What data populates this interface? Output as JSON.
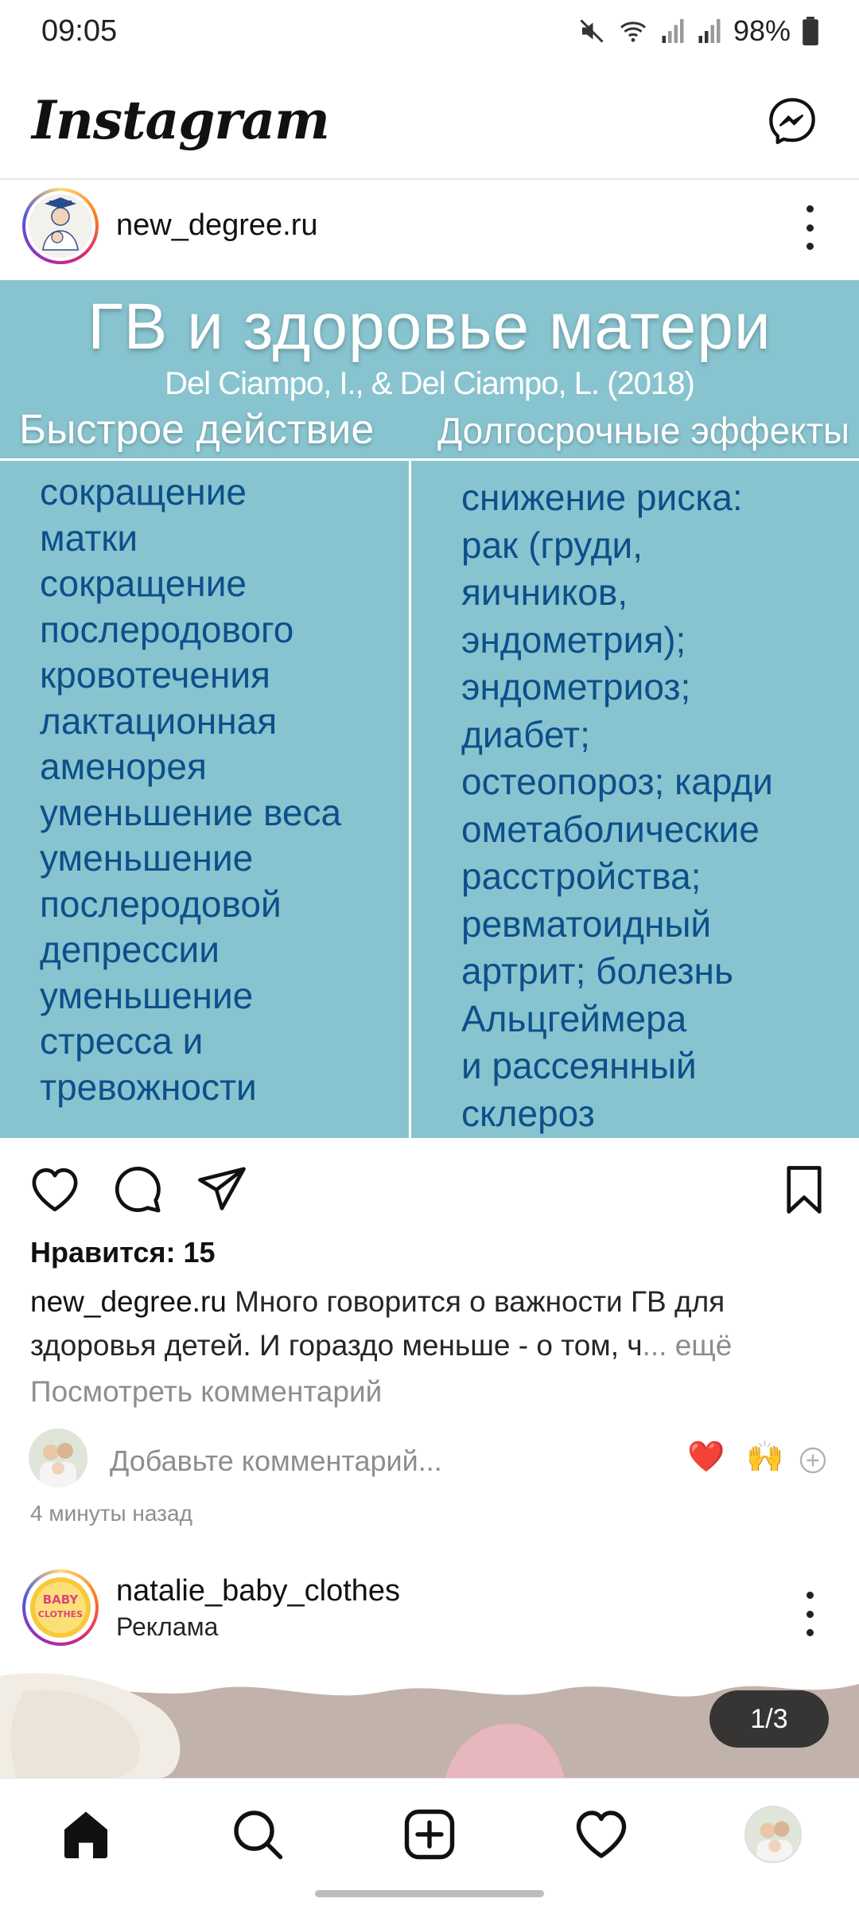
{
  "status": {
    "time": "09:05",
    "battery": "98%",
    "icons": [
      "mute-icon",
      "wifi-icon",
      "signal-icon",
      "signal-icon",
      "battery-icon"
    ]
  },
  "header": {
    "logo": "Instagram",
    "messenger_icon": "messenger-icon"
  },
  "post": {
    "username": "new_degree.ru",
    "image": {
      "title": "ГВ и здоровье матери",
      "subtitle": "Del Ciampo, I., & Del Ciampo, L. (2018)",
      "left_heading": "Быстрое действие",
      "right_heading": "Долгосрочные эффекты",
      "left_text": "сокращение\nматки\nсокращение\nпослеродового\nкровотечения\nлактационная\nаменорея\nуменьшение веса\nуменьшение\nпослеродовой\nдепрессии\nуменьшение\nстресса и\nтревожности",
      "right_text": "снижение риска:\nрак (груди,\nяичников,\nэндометрия);\nэндометриоз;\nдиабет;\nостеопороз; карди\nометаболические\nрасстройства;\nревматоидный\nартрит; болезнь\nАльцгеймера\nи рассеянный\nсклероз"
    },
    "likes": "Нравится: 15",
    "caption_user": "new_degree.ru",
    "caption_text": "Много говорится о важности ГВ для здоровья детей. И гораздо меньше - о том, ч",
    "caption_more": "... ещё",
    "view_comments": "Посмотреть комментарий",
    "comment_placeholder": "Добавьте комментарий...",
    "quick_emojis": [
      "❤️",
      "🙌"
    ],
    "time_ago": "4 минуты назад"
  },
  "post2": {
    "username": "natalie_baby_clothes",
    "sponsored": "Реклама",
    "counter": "1/3"
  },
  "nav": {
    "items": [
      "home-icon",
      "search-icon",
      "create-icon",
      "activity-icon",
      "profile-avatar"
    ]
  }
}
